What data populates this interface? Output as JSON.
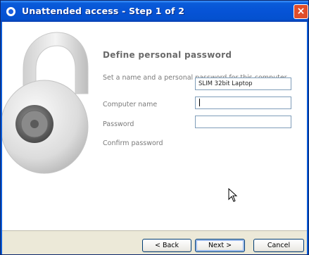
{
  "window": {
    "title": "Unattended access - Step 1 of 2",
    "close_glyph": "×"
  },
  "page": {
    "heading": "Define personal password",
    "description": "Set a name and a personal password for this computer."
  },
  "form": {
    "computer_name_label": "Computer name",
    "computer_name_value": "SLIM 32bit Laptop",
    "password_label": "Password",
    "password_value": "",
    "confirm_label": "Confirm password",
    "confirm_value": ""
  },
  "buttons": {
    "back": "< Back",
    "next": "Next >",
    "cancel": "Cancel"
  },
  "icons": {
    "title": "teamviewer-icon",
    "illustration": "padlock-icon",
    "pointer": "mouse-pointer-icon"
  },
  "colors": {
    "titlebar": "#0653d6",
    "accent_border": "#7f9db9",
    "close_button": "#e14e2a"
  }
}
